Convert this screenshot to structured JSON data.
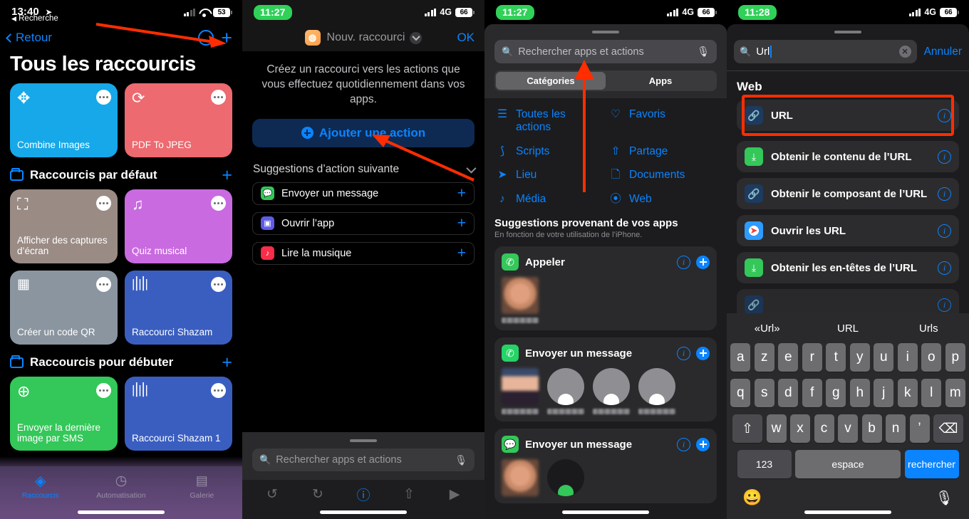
{
  "panel1": {
    "status": {
      "time": "13:40",
      "back_label": "Recherche",
      "battery": "53"
    },
    "nav": {
      "back": "Retour"
    },
    "title": "Tous les raccourcis",
    "top_cards": [
      {
        "name": "Combine Images",
        "color": "#16a8e8",
        "icon": "puzzle-icon",
        "glyph": "❖"
      },
      {
        "name": "PDF To JPEG",
        "color": "#ec6a70",
        "icon": "refresh-icon",
        "glyph": "⟳"
      }
    ],
    "sections": [
      {
        "title": "Raccourcis par défaut",
        "cards": [
          {
            "name": "Afficher des captures d’écran",
            "color": "#9a8b85",
            "icon": "screenshot-icon",
            "glyph": "⌗"
          },
          {
            "name": "Quiz musical",
            "color": "#c96ae0",
            "icon": "music-list-icon",
            "glyph": "♫"
          },
          {
            "name": "Créer un code QR",
            "color": "#8a95a0",
            "icon": "qr-icon",
            "glyph": "░"
          },
          {
            "name": "Raccourci Shazam",
            "color": "#3a5ec0",
            "icon": "waveform-icon",
            "glyph": "⌇"
          }
        ]
      },
      {
        "title": "Raccourcis pour débuter",
        "cards": [
          {
            "name": "Envoyer la dernière image par SMS",
            "color": "#34c759",
            "icon": "message-plus-icon",
            "glyph": "⊕"
          },
          {
            "name": "Raccourci Shazam 1",
            "color": "#3a5ec0",
            "icon": "waveform-icon",
            "glyph": "⌇"
          }
        ]
      }
    ],
    "tabs": [
      {
        "label": "Raccourcis",
        "icon": "layers-icon",
        "active": true
      },
      {
        "label": "Automatisation",
        "icon": "clock-check-icon",
        "active": false
      },
      {
        "label": "Galerie",
        "icon": "gallery-icon",
        "active": false
      }
    ]
  },
  "panel2": {
    "status": {
      "time": "11:27",
      "network": "4G",
      "battery": "66"
    },
    "nav": {
      "title": "Nouv. raccourci",
      "done": "OK",
      "app_icon": "shortcuts-icon"
    },
    "description": "Créez un raccourci vers les actions que vous effectuez quotidiennement dans vos apps.",
    "add_action_button": "Ajouter une action",
    "suggestions_header": "Suggestions d’action suivante",
    "suggestions": [
      {
        "label": "Envoyer un message",
        "icon": "messages-icon",
        "color": "#34c759",
        "glyph": "💬"
      },
      {
        "label": "Ouvrir l’app",
        "icon": "open-app-icon",
        "color": "#5e5ce6",
        "glyph": "▣"
      },
      {
        "label": "Lire la musique",
        "icon": "music-icon",
        "color": "#fa2d48",
        "glyph": "♪"
      }
    ],
    "search_placeholder": "Rechercher apps et actions",
    "toolbar": [
      {
        "name": "undo-icon",
        "glyph": "↺",
        "active": false
      },
      {
        "name": "redo-icon",
        "glyph": "↻",
        "active": false
      },
      {
        "name": "info-icon",
        "glyph": "ⓘ",
        "active": true
      },
      {
        "name": "share-icon",
        "glyph": "⇧",
        "active": false
      },
      {
        "name": "play-icon",
        "glyph": "▶",
        "active": false
      }
    ]
  },
  "panel3": {
    "status": {
      "time": "11:27",
      "network": "4G",
      "battery": "66"
    },
    "search_placeholder": "Rechercher apps et actions",
    "segments": [
      {
        "label": "Catégories",
        "selected": true
      },
      {
        "label": "Apps",
        "selected": false
      }
    ],
    "categories": [
      {
        "label": "Toutes les actions",
        "icon": "list-icon",
        "glyph": "≡"
      },
      {
        "label": "Favoris",
        "icon": "heart-icon",
        "glyph": "♡"
      },
      {
        "label": "Scripts",
        "icon": "script-icon",
        "glyph": "∵"
      },
      {
        "label": "Partage",
        "icon": "share-icon",
        "glyph": "⇧"
      },
      {
        "label": "Lieu",
        "icon": "location-arrow-icon",
        "glyph": "➤"
      },
      {
        "label": "Documents",
        "icon": "document-icon",
        "glyph": "⬚"
      },
      {
        "label": "Média",
        "icon": "music-note-icon",
        "glyph": "♪"
      },
      {
        "label": "Web",
        "icon": "safari-compass-icon",
        "glyph": "⦿"
      }
    ],
    "suggestions_title": "Suggestions provenant de vos apps",
    "suggestions_subtitle": "En fonction de votre utilisation de l’iPhone.",
    "suggestion_cards": [
      {
        "label": "Appeler",
        "app_icon": "phone-icon",
        "color": "#34c759",
        "glyph": "✆",
        "contacts": 1
      },
      {
        "label": "Envoyer un message",
        "app_icon": "whatsapp-icon",
        "color": "#25d366",
        "glyph": "✆",
        "contacts": 4
      },
      {
        "label": "Envoyer un message",
        "app_icon": "messages-icon",
        "color": "#34c759",
        "glyph": "💬",
        "contacts": 2
      }
    ]
  },
  "panel4": {
    "status": {
      "time": "11:28",
      "network": "4G",
      "battery": "66"
    },
    "search_value": "Url",
    "cancel_label": "Annuler",
    "section_title": "Web",
    "results": [
      {
        "label": "URL",
        "icon": "link-icon",
        "color": "#1d3a5f",
        "glyph": "🔗",
        "highlighted": true
      },
      {
        "label": "Obtenir le contenu de l’URL",
        "icon": "download-box-icon",
        "color": "#34c759",
        "glyph": "⤓",
        "highlighted": false
      },
      {
        "label": "Obtenir le composant de l’URL",
        "icon": "link-icon",
        "color": "#1d3a5f",
        "glyph": "🔗",
        "highlighted": false
      },
      {
        "label": "Ouvrir les URL",
        "icon": "safari-icon",
        "color": "#ffffff",
        "glyph": "🧭",
        "highlighted": false
      },
      {
        "label": "Obtenir les en-têtes de l’URL",
        "icon": "download-box-icon",
        "color": "#34c759",
        "glyph": "⤓",
        "highlighted": false
      }
    ],
    "keyboard": {
      "predictions": [
        "«Url»",
        "URL",
        "Urls"
      ],
      "row1": [
        "a",
        "z",
        "e",
        "r",
        "t",
        "y",
        "u",
        "i",
        "o",
        "p"
      ],
      "row2": [
        "q",
        "s",
        "d",
        "f",
        "g",
        "h",
        "j",
        "k",
        "l",
        "m"
      ],
      "row3": [
        "w",
        "x",
        "c",
        "v",
        "b",
        "n",
        "’"
      ],
      "shift": "⇧",
      "backspace": "⌫",
      "numbers": "123",
      "space": "espace",
      "enter": "rechercher",
      "emoji_icon": "emoji-icon",
      "mic_icon": "microphone-icon"
    }
  }
}
